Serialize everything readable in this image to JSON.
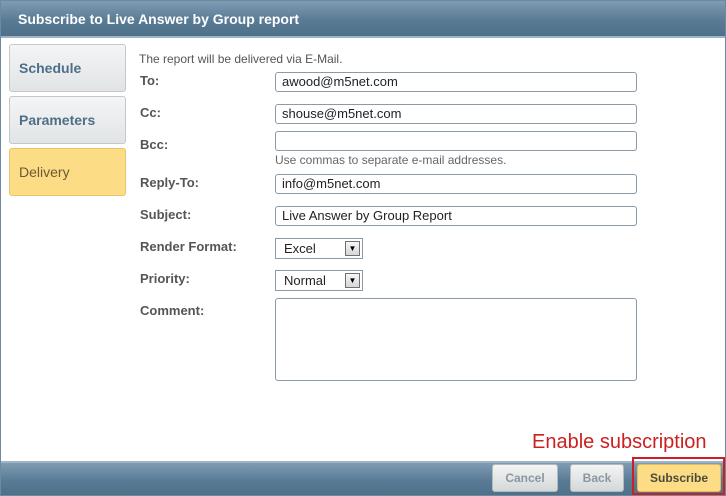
{
  "dialog": {
    "title": "Subscribe to Live Answer by Group report"
  },
  "tabs": [
    {
      "label": "Schedule"
    },
    {
      "label": "Parameters"
    },
    {
      "label": "Delivery"
    }
  ],
  "form": {
    "info": "The report will be delivered via E-Mail.",
    "to_label": "To:",
    "to_value": "awood@m5net.com",
    "cc_label": "Cc:",
    "cc_value": "shouse@m5net.com",
    "bcc_label": "Bcc:",
    "bcc_value": "",
    "bcc_hint": "Use commas to separate e-mail addresses.",
    "replyto_label": "Reply-To:",
    "replyto_value": "info@m5net.com",
    "subject_label": "Subject:",
    "subject_value": "Live Answer by Group Report",
    "render_label": "Render Format:",
    "render_value": "Excel",
    "priority_label": "Priority:",
    "priority_value": "Normal",
    "comment_label": "Comment:",
    "comment_value": ""
  },
  "annotation": "Enable subscription",
  "footer": {
    "cancel_label": "Cancel",
    "back_label": "Back",
    "subscribe_label": "Subscribe"
  },
  "colors": {
    "accent_active": "#fddc86",
    "header": "#5a7b95",
    "annotation": "#cc1f1f"
  }
}
